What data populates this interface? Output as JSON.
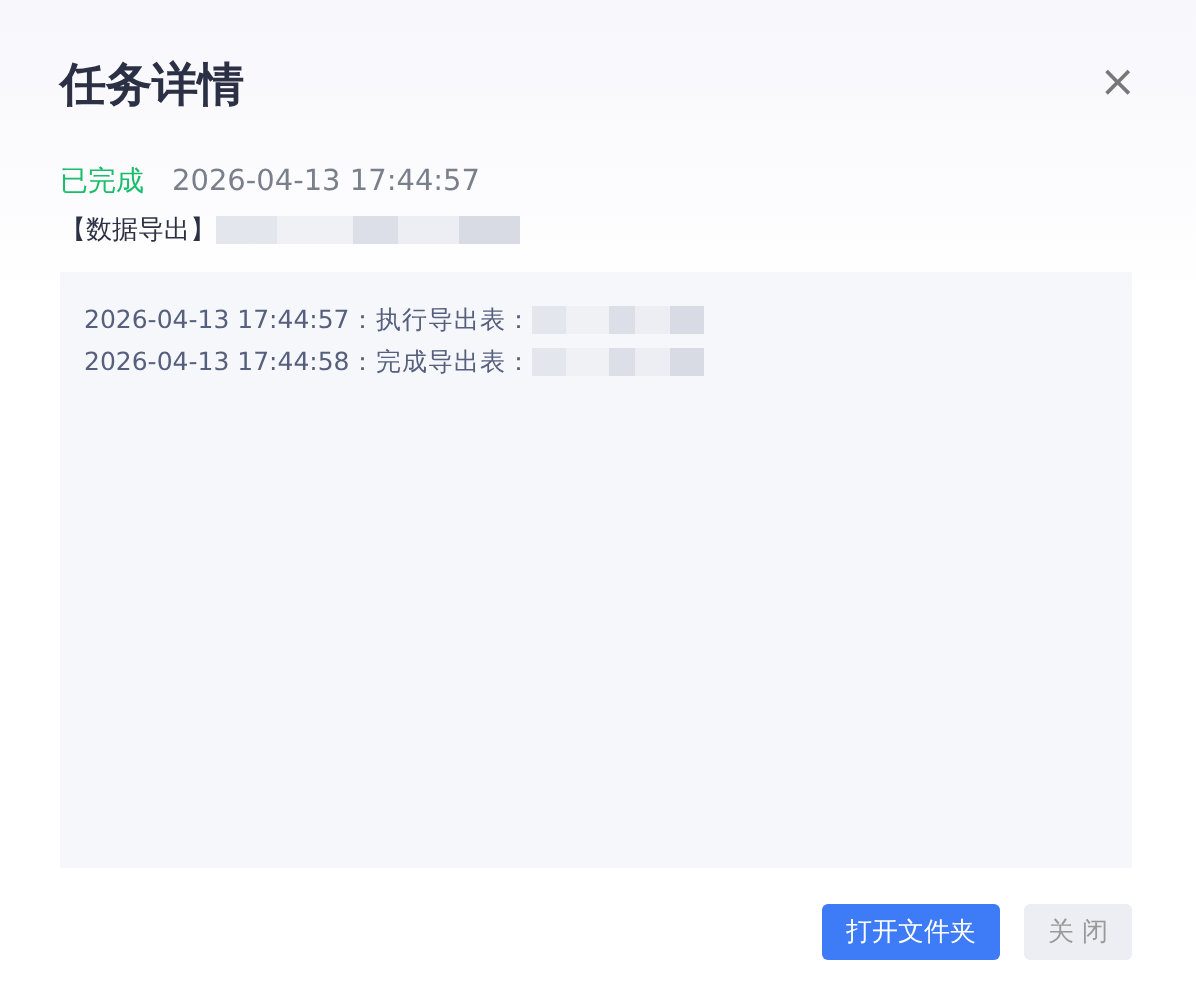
{
  "dialog": {
    "title": "任务详情",
    "close_icon": "×"
  },
  "status": {
    "kind": "done",
    "label": "已完成",
    "time": "2026-04-13 17:44:57"
  },
  "task_label": "【数据导出】",
  "log": [
    {
      "time": "2026-04-13 17:44:57",
      "message": "：执行导出表："
    },
    {
      "time": "2026-04-13 17:44:58",
      "message": "：完成导出表："
    }
  ],
  "buttons": [
    {
      "label": "打开文件夹",
      "kind": "primary",
      "disabled": false
    },
    {
      "label": "关 闭",
      "kind": "default",
      "disabled": true
    }
  ]
}
